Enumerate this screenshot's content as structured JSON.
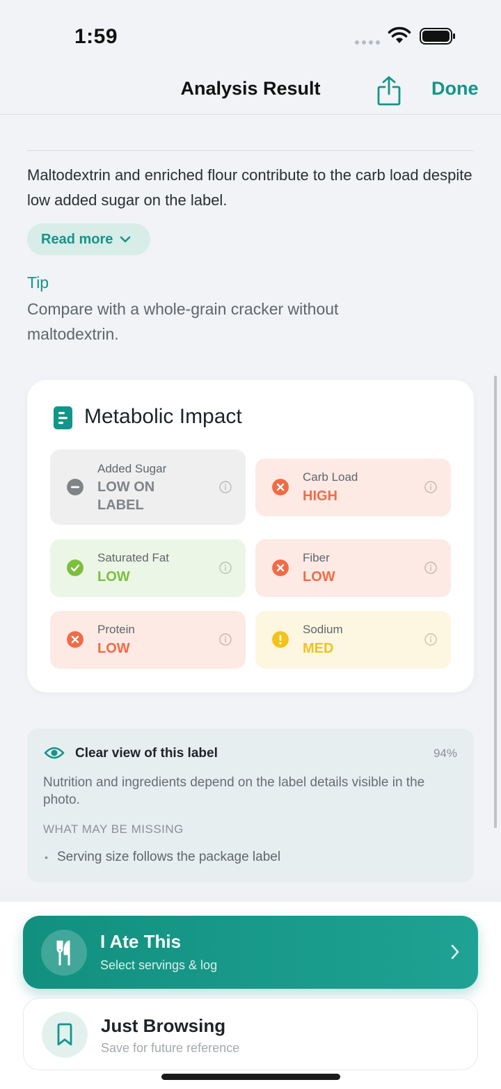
{
  "status_bar": {
    "time": "1:59"
  },
  "nav": {
    "title": "Analysis Result",
    "done_label": "Done",
    "share_icon": "share-icon"
  },
  "summary": {
    "text": "Maltodextrin and enriched flour contribute to the carb load despite low added sugar on the label.",
    "read_more_label": "Read more"
  },
  "tip": {
    "title": "Tip",
    "text": "Compare with a whole-grain cracker without maltodextrin."
  },
  "metabolic": {
    "title": "Metabolic Impact",
    "metrics": [
      {
        "label": "Added Sugar",
        "value": "LOW ON LABEL",
        "status": "neutral"
      },
      {
        "label": "Carb Load",
        "value": "HIGH",
        "status": "bad"
      },
      {
        "label": "Saturated Fat",
        "value": "LOW",
        "status": "good"
      },
      {
        "label": "Fiber",
        "value": "LOW",
        "status": "bad"
      },
      {
        "label": "Protein",
        "value": "LOW",
        "status": "bad"
      },
      {
        "label": "Sodium",
        "value": "MED",
        "status": "warn"
      }
    ]
  },
  "clear_view": {
    "title": "Clear view of this label",
    "percent": "94%",
    "description": "Nutrition and ingredients depend on the label details visible in the photo.",
    "missing_heading": "WHAT MAY BE MISSING",
    "missing_items": [
      "Serving size follows the package label"
    ]
  },
  "actions": {
    "ate": {
      "title": "I Ate This",
      "subtitle": "Select servings & log"
    },
    "browse": {
      "title": "Just Browsing",
      "subtitle": "Save for future reference"
    }
  },
  "colors": {
    "accent": "#13958a",
    "bad": "#f26b47",
    "good": "#7cbf3e",
    "warn": "#f3c21b",
    "neutral": "#7f8489"
  }
}
